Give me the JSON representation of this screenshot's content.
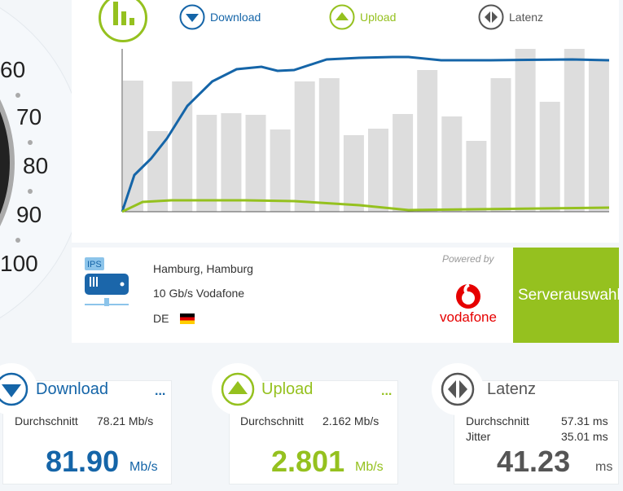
{
  "gauge": {
    "scale_labels": [
      "60",
      "70",
      "80",
      "90",
      "100"
    ]
  },
  "chart_legend": {
    "download": "Download",
    "upload": "Upload",
    "latency": "Latenz"
  },
  "colors": {
    "download": "#1565a8",
    "upload": "#95c11f",
    "latency": "#555555",
    "bars": "#dddddd",
    "vodafone": "#e60000"
  },
  "chart_data": {
    "type": "bar+line",
    "bars": {
      "name": "Latenz",
      "values": [
        80.5,
        49.5,
        80,
        59.5,
        60.5,
        59.5,
        50.5,
        80,
        82,
        47,
        51,
        60,
        87,
        58.5,
        43.5,
        82,
        100,
        67.5,
        100,
        92.5
      ]
    },
    "series": [
      {
        "name": "Download",
        "x": [
          0,
          2.5,
          5.9,
          9.2,
          13.4,
          18.5,
          23.5,
          28.6,
          31.9,
          35.3,
          42,
          48.7,
          55.5,
          58.8,
          65.5,
          75.6,
          92.4,
          100
        ],
        "y": [
          0,
          22.5,
          32.5,
          45,
          65,
          80,
          87.5,
          89,
          86.5,
          87,
          93.5,
          94.5,
          95,
          95,
          93,
          93,
          93.5,
          93
        ]
      },
      {
        "name": "Upload",
        "x": [
          0,
          4.2,
          10.1,
          25.2,
          35.3,
          48.7,
          58.8,
          100
        ],
        "y": [
          0,
          6,
          7,
          7,
          6.5,
          4,
          1,
          2.5
        ]
      }
    ],
    "grid": false
  },
  "server": {
    "city": "Hamburg, Hamburg",
    "provider": "10 Gb/s Vodafone",
    "country": "DE",
    "icon_label": "IPS",
    "powered_by": "Powered by",
    "sponsor": "vodafone",
    "select_button": "Serverauswahl"
  },
  "results": {
    "download": {
      "title": "Download",
      "more": "...",
      "avg_label": "Durchschnitt",
      "avg_value": "78.21 Mb/s",
      "value": "81.90",
      "unit": "Mb/s"
    },
    "upload": {
      "title": "Upload",
      "more": "...",
      "avg_label": "Durchschnitt",
      "avg_value": "2.162 Mb/s",
      "value": "2.801",
      "unit": "Mb/s"
    },
    "latency": {
      "title": "Latenz",
      "avg_label": "Durchschnitt",
      "avg_value": "57.31 ms",
      "jitter_label": "Jitter",
      "jitter_value": "35.01 ms",
      "value": "41.23",
      "unit": "ms"
    }
  }
}
